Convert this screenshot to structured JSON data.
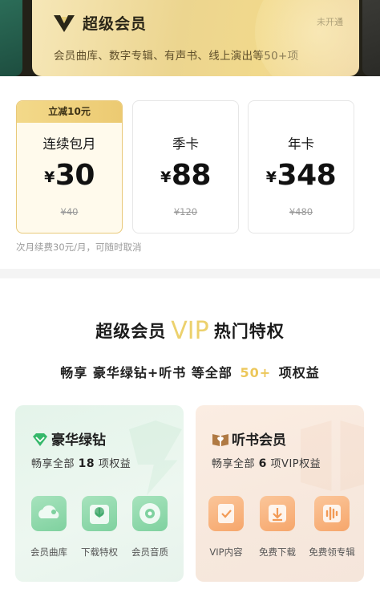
{
  "banner": {
    "title": "超级会员",
    "status": "未开通",
    "desc": "会员曲库、数字专辑、有声书、线上演出等50+项"
  },
  "plans": [
    {
      "tag": "立减10元",
      "name": "连续包月",
      "currency": "¥",
      "price": "30",
      "original": "¥40",
      "selected": true
    },
    {
      "tag": "",
      "name": "季卡",
      "currency": "¥",
      "price": "88",
      "original": "¥120",
      "selected": false
    },
    {
      "tag": "",
      "name": "年卡",
      "currency": "¥",
      "price": "348",
      "original": "¥480",
      "selected": false
    }
  ],
  "renew_note": "次月续费30元/月，可随时取消",
  "privileges": {
    "title_pre": "超级会员",
    "title_vip": "VIP",
    "title_post": "热门特权",
    "sub_pre": "畅享 豪华绿钻+听书 等全部",
    "sub_num": "50+",
    "sub_post": "项权益"
  },
  "panels": {
    "green": {
      "title": "豪华绿钻",
      "desc_pre": "畅享全部",
      "desc_num": "18",
      "desc_post": "项权益",
      "features": [
        "会员曲库",
        "下载特权",
        "会员音质"
      ]
    },
    "peach": {
      "title": "听书会员",
      "desc_pre": "畅享全部",
      "desc_num": "6",
      "desc_post": "项VIP权益",
      "features": [
        "VIP内容",
        "免费下载",
        "免费领专辑"
      ]
    }
  },
  "colors": {
    "gold": "#ecd16d",
    "green_accent": "#35b86a",
    "peach_accent": "#f29a55"
  }
}
